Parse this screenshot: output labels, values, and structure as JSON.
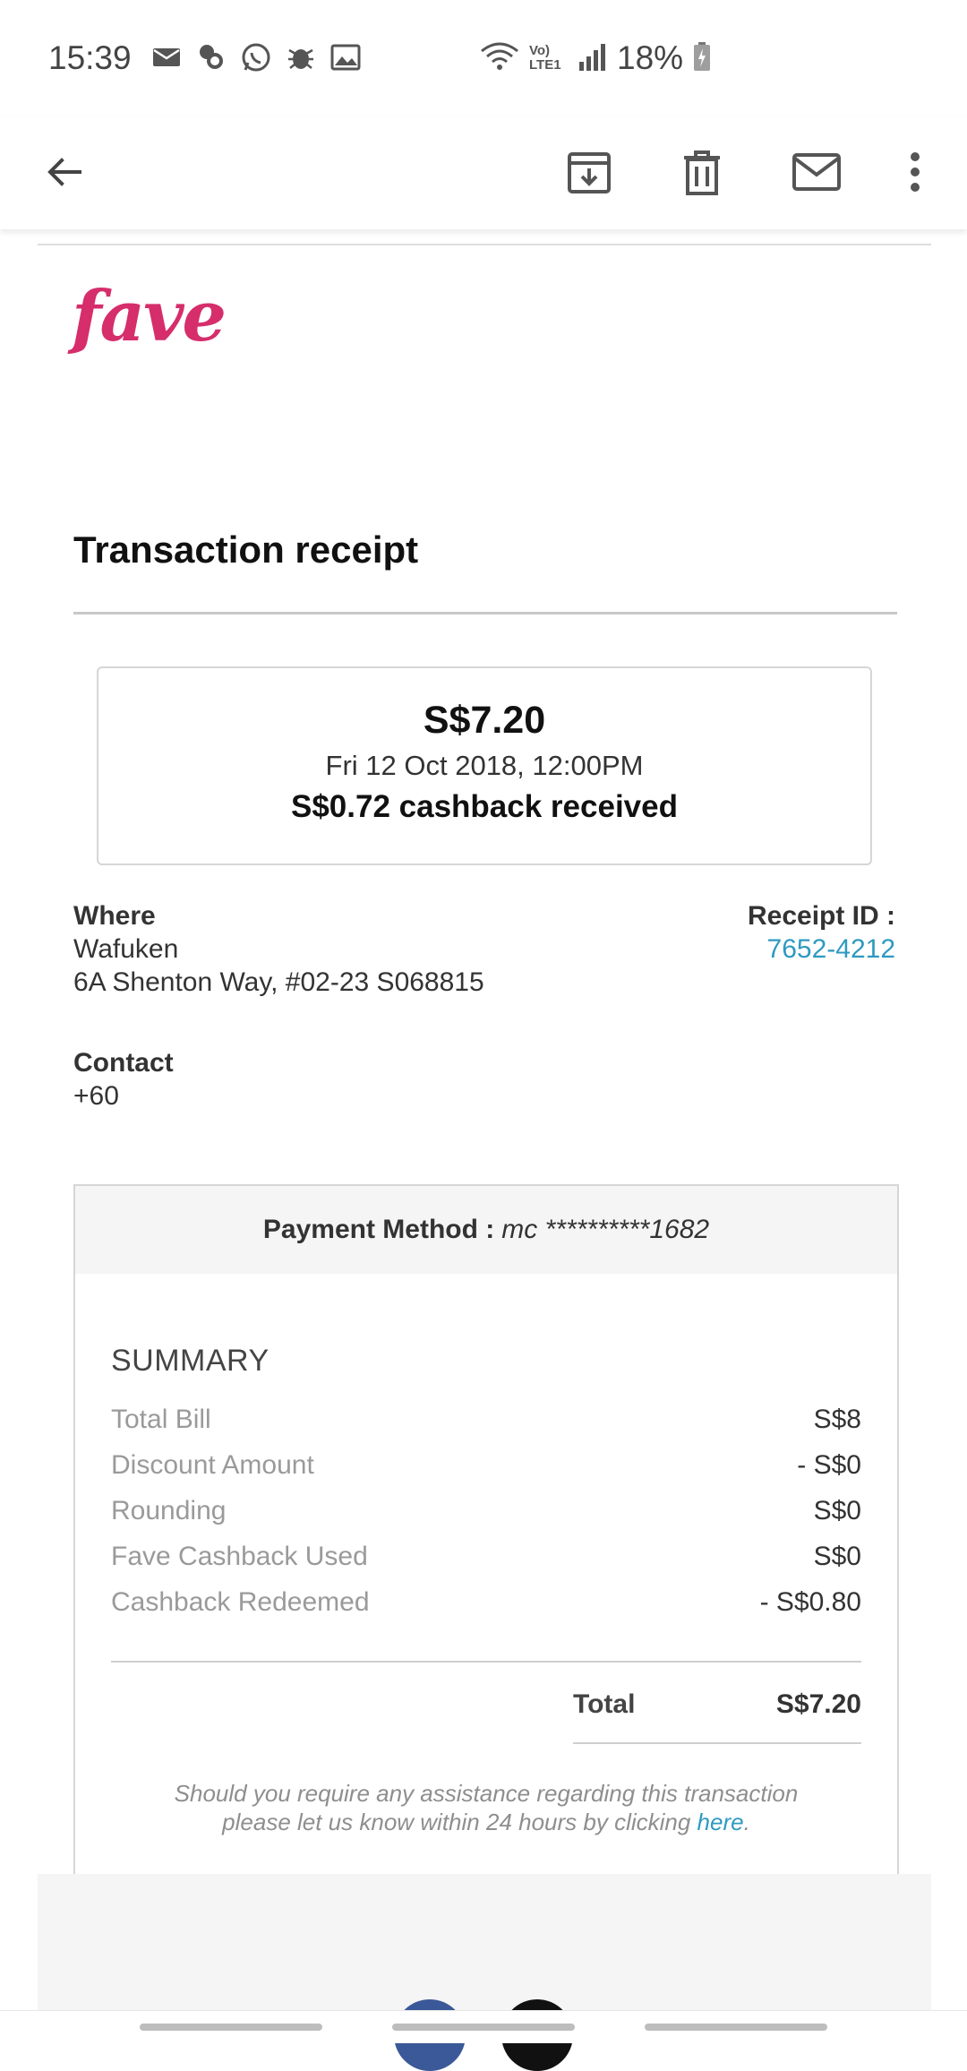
{
  "status_bar": {
    "time": "15:39",
    "notification_icons": [
      "mail-icon",
      "chat-icon",
      "whatsapp-icon",
      "bug-icon",
      "image-icon"
    ],
    "signal_text": "Vo) LTE1",
    "battery_percent": "18%"
  },
  "app_bar": {
    "back_icon": "arrow-left-icon",
    "actions": [
      "archive-icon",
      "trash-icon",
      "mail-icon",
      "more-vert-icon"
    ]
  },
  "email": {
    "brand": "fave",
    "brand_color": "#d62d6b",
    "title": "Transaction receipt",
    "amount": "S$7.20",
    "date": "Fri 12 Oct 2018, 12:00PM",
    "cashback": "S$0.72 cashback received",
    "where_label": "Where",
    "merchant": "Wafuken",
    "address": "6A Shenton Way, #02-23 S068815",
    "receipt_label": "Receipt ID :",
    "receipt_id": "7652-4212",
    "contact_label": "Contact",
    "contact": "+60",
    "payment_label": "Payment Method :",
    "payment_value": "mc **********1682",
    "summary_title": "SUMMARY",
    "summary_rows": [
      {
        "label": "Total Bill",
        "value": "S$8"
      },
      {
        "label": "Discount Amount",
        "value": "- S$0"
      },
      {
        "label": "Rounding",
        "value": "S$0"
      },
      {
        "label": "Fave Cashback Used",
        "value": "S$0"
      },
      {
        "label": "Cashback Redeemed",
        "value": "- S$0.80"
      }
    ],
    "total_label": "Total",
    "total_value": "S$7.20",
    "note_line1": "Should you require any assistance regarding this transaction",
    "note_line2_prefix": "please let us know within 24 hours by clicking ",
    "note_link": "here",
    "note_suffix": ".",
    "link_color": "#2e9ac0"
  }
}
